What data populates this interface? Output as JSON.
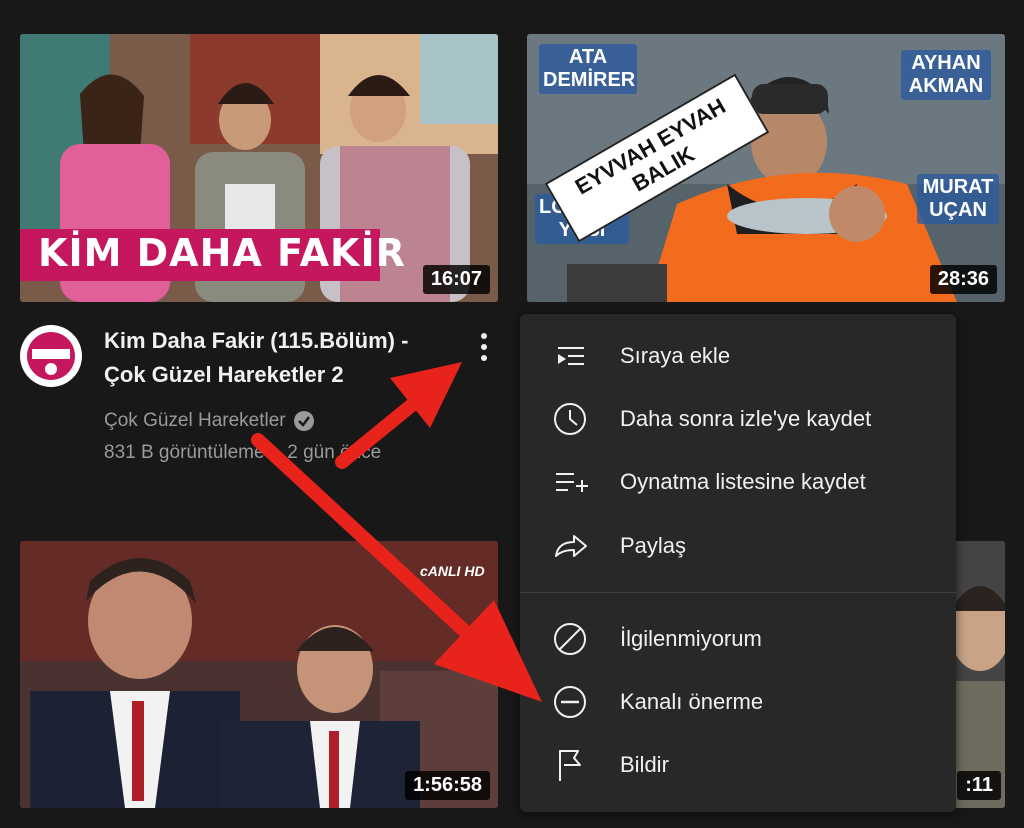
{
  "videos": [
    {
      "duration": "16:07",
      "overlay_title": "KİM DAHA FAKİR"
    },
    {
      "duration": "28:36",
      "overlay_title": "EYVVAH EYVAH BALIK",
      "names": [
        "ATA DEMİRER",
        "AYHAN AKMAN",
        "LOKMAN YUSİ",
        "MURAT UÇAN"
      ]
    },
    {
      "duration": "1:56:58",
      "logo": "cANLI HD"
    },
    {
      "duration": ":11"
    }
  ],
  "main_video": {
    "title_line1": "Kim Daha Fakir (115.Bölüm) -",
    "title_line2": "Çok Güzel Hareketler 2",
    "channel": "Çok Güzel Hareketler",
    "views": "831 B görüntüleme",
    "separator": "•",
    "age": "2 gün önce"
  },
  "menu": {
    "items": [
      {
        "label": "Sıraya ekle",
        "icon": "add-to-queue-icon"
      },
      {
        "label": "Daha sonra izle'ye kaydet",
        "icon": "clock-icon"
      },
      {
        "label": "Oynatma listesine kaydet",
        "icon": "playlist-add-icon"
      },
      {
        "label": "Paylaş",
        "icon": "share-icon"
      },
      {
        "label": "İlgilenmiyorum",
        "icon": "not-interested-icon"
      },
      {
        "label": "Kanalı önerme",
        "icon": "minus-circle-icon"
      },
      {
        "label": "Bildir",
        "icon": "flag-icon"
      }
    ]
  },
  "colors": {
    "background": "#181818",
    "menu_background": "#282828",
    "arrow": "#e8231c",
    "banner_pink": "#c5175e"
  }
}
